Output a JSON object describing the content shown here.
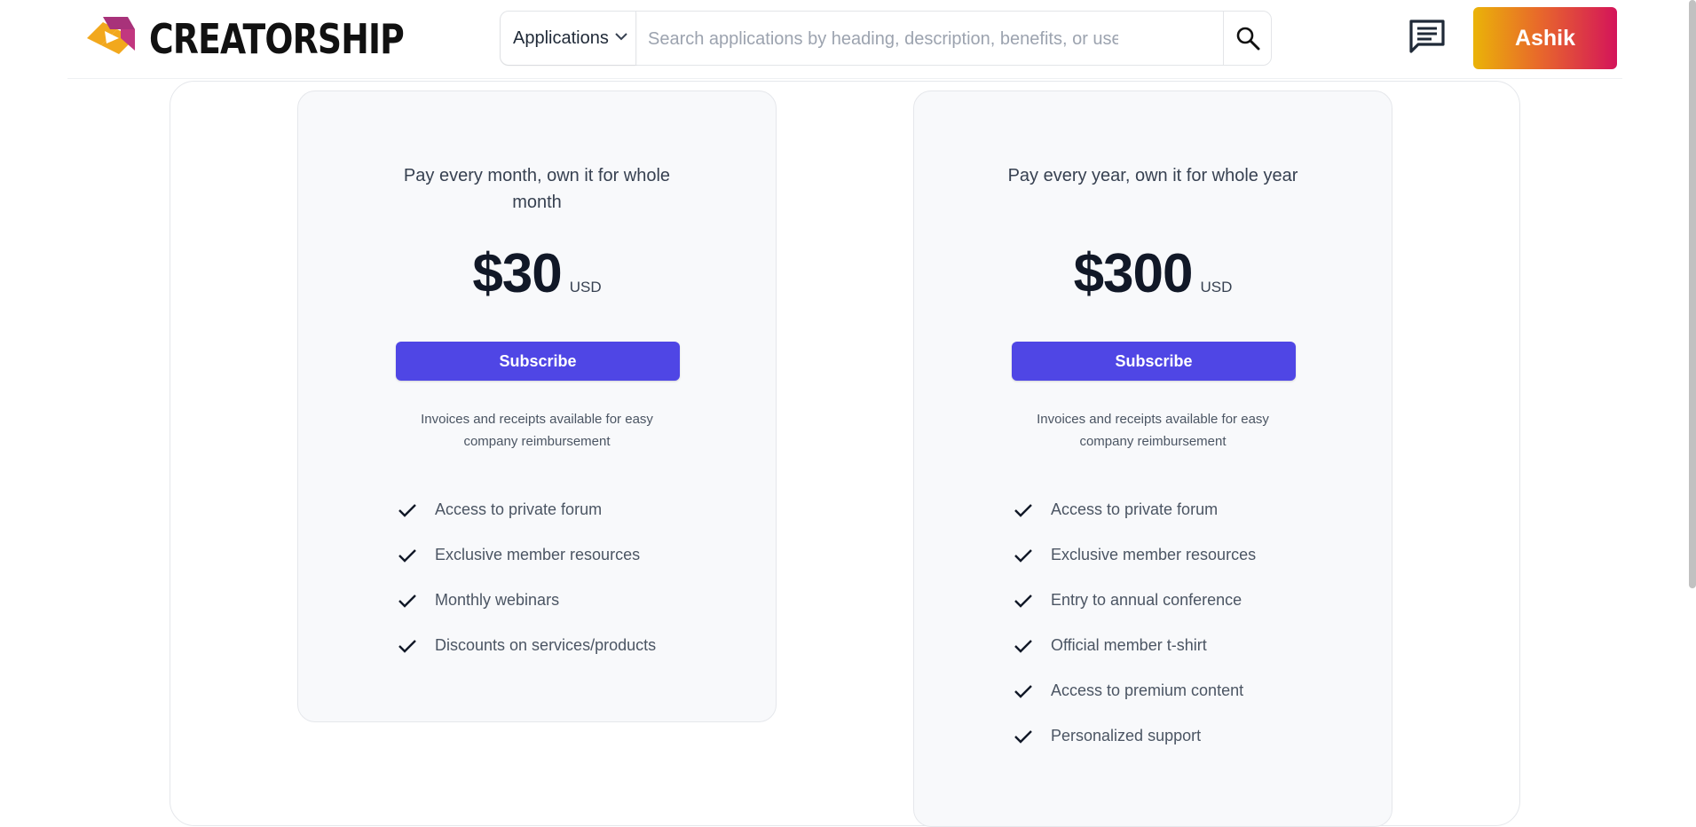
{
  "header": {
    "brand": "CREATORSHIP",
    "dropdown_label": "Applications",
    "search_placeholder": "Search applications by heading, description, benefits, or user...",
    "user_name": "Ashik",
    "icons": {
      "logo": "creatorship-logo",
      "chevron": "chevron-down-icon",
      "search": "search-icon",
      "chat": "chat-icon"
    }
  },
  "plans": [
    {
      "title": "Pay every month, own it for whole month",
      "price": "$30",
      "currency": "USD",
      "button": "Subscribe",
      "note": "Invoices and receipts available for easy company reimbursement",
      "features": [
        "Access to private forum",
        "Exclusive member resources",
        "Monthly webinars",
        "Discounts on services/products"
      ]
    },
    {
      "title": "Pay every year, own it for whole year",
      "price": "$300",
      "currency": "USD",
      "button": "Subscribe",
      "note": "Invoices and receipts available for easy company reimbursement",
      "features": [
        "Access to private forum",
        "Exclusive member resources",
        "Entry to annual conference",
        "Official member t-shirt",
        "Access to premium content",
        "Personalized support"
      ]
    }
  ],
  "colors": {
    "accent": "#4f46e5",
    "user_gradient_start": "#eab308",
    "user_gradient_end": "#d4145a"
  }
}
